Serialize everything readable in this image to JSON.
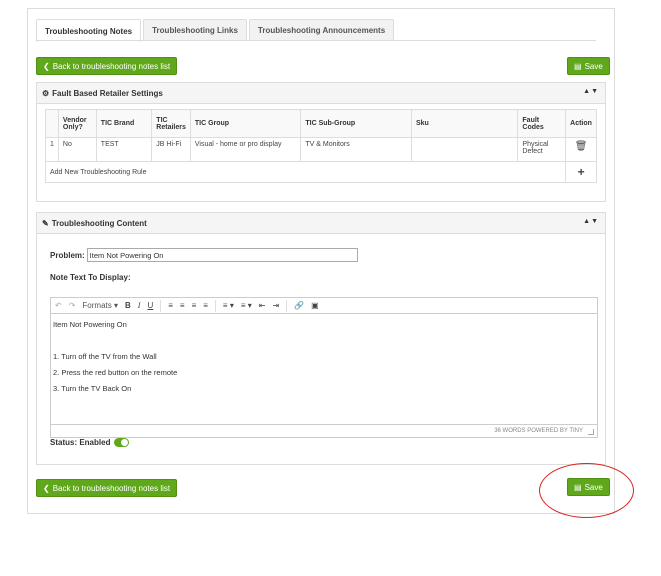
{
  "tabs": [
    {
      "label": "Troubleshooting Notes",
      "active": true
    },
    {
      "label": "Troubleshooting Links",
      "active": false
    },
    {
      "label": "Troubleshooting Announcements",
      "active": false
    }
  ],
  "actions": {
    "back_label": "Back to troubleshooting notes list",
    "save_label": "Save"
  },
  "retailer_panel": {
    "title": "Fault Based Retailer Settings",
    "columns": [
      "",
      "Vendor Only?",
      "TIC Brand",
      "TIC Retailers",
      "TIC Group",
      "TIC Sub-Group",
      "Sku",
      "Fault Codes",
      "Action"
    ],
    "rows": [
      {
        "num": "1",
        "vendor_only": "No",
        "brand": "TEST",
        "retailers": "JB Hi-Fi",
        "group": "Visual - home or pro display",
        "sub_group": "TV & Monitors",
        "sku": "",
        "fault_codes": "Physical Defect"
      }
    ],
    "add_rule_label": "Add New Troubleshooting Rule"
  },
  "content_panel": {
    "title": "Troubleshooting Content",
    "problem_label": "Problem:",
    "problem_value": "Item Not Powering On",
    "note_label": "Note Text To Display:",
    "formats_label": "Formats",
    "editor_lines": [
      "Item Not Powering On",
      "",
      "1. Turn off the TV from the Wall",
      "2. Press the red button on the remote",
      "3. Turn the TV Back On"
    ],
    "editor_status": "36 WORDS POWERED BY TINY",
    "status_label": "Status: Enabled",
    "status_enabled": true
  },
  "colors": {
    "accent_green": "#5fa81b",
    "highlight_red": "#d9231e"
  }
}
